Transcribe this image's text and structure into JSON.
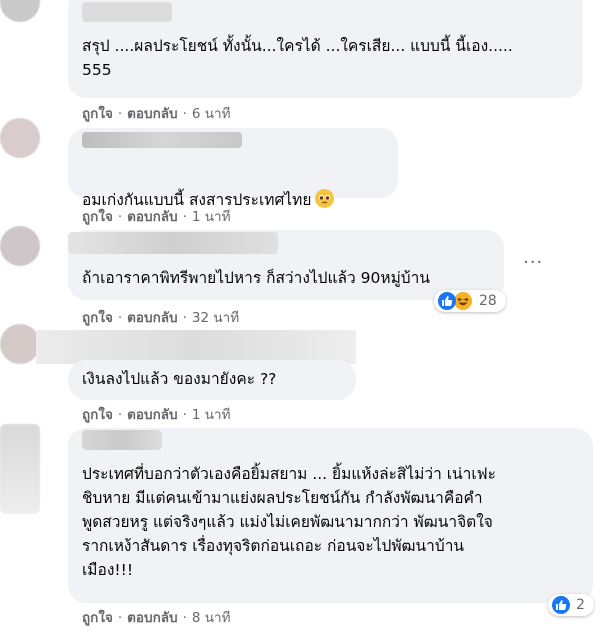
{
  "comments": [
    {
      "text": "สรุป ....ผลประโยชน์ ทั้งนั้น...ใครได้ ...ใครเสีย... แบบนี้ นี้เอง.....\n555",
      "actions": {
        "like": "ถูกใจ",
        "reply": "ตอบกลับ",
        "time": "6 นาที"
      }
    },
    {
      "text": "อมเก่งกันแบบนี้ สงสารประเทศไทย",
      "emoji": "pleading-face-emoji",
      "actions": {
        "like": "ถูกใจ",
        "reply": "ตอบกลับ",
        "time": "1 นาที"
      }
    },
    {
      "text": "ถ้าเอาราคาพิทรีพายไปหาร ก็สว่างไปแล้ว 90หมู่บ้าน",
      "reactions": {
        "icons": [
          "like-icon",
          "haha-icon"
        ],
        "count": "28"
      },
      "actions": {
        "like": "ถูกใจ",
        "reply": "ตอบกลับ",
        "time": "32 นาที"
      }
    },
    {
      "text": "เงินลงไปแล้ว ของมายังคะ ??",
      "actions": {
        "like": "ถูกใจ",
        "reply": "ตอบกลับ",
        "time": "1 นาที"
      }
    },
    {
      "text": "ประเทศที่บอกว่าตัวเองคือยิ้มสยาม ... ยิ้มแห้งล่ะสิไม่ว่า เน่าเฟะ\nชิบหาย มีแต่คนเข้ามาแย่งผลประโยชน์กัน กำลังพัฒนาคือคำ\nพูดสวยหรู แต่จริงๆแล้ว แม่งไม่เคยพัฒนามากกว่า พัฒนาจิตใจ\nรากเหง้าสันดาร เรื่องทุจริตก่อนเถอะ ก่อนจะไปพัฒนาบ้าน\nเมือง!!!",
      "reactions": {
        "icons": [
          "like-icon"
        ],
        "count": "2"
      },
      "actions": {
        "like": "ถูกใจ",
        "reply": "ตอบกลับ",
        "time": "8 นาที"
      }
    }
  ],
  "more_options_glyph": "···",
  "separator": "·",
  "colors": {
    "bubble": "#f0f2f5",
    "meta": "#65676b",
    "like_blue": "#1877f2",
    "haha_yellow": "#f7b125"
  }
}
